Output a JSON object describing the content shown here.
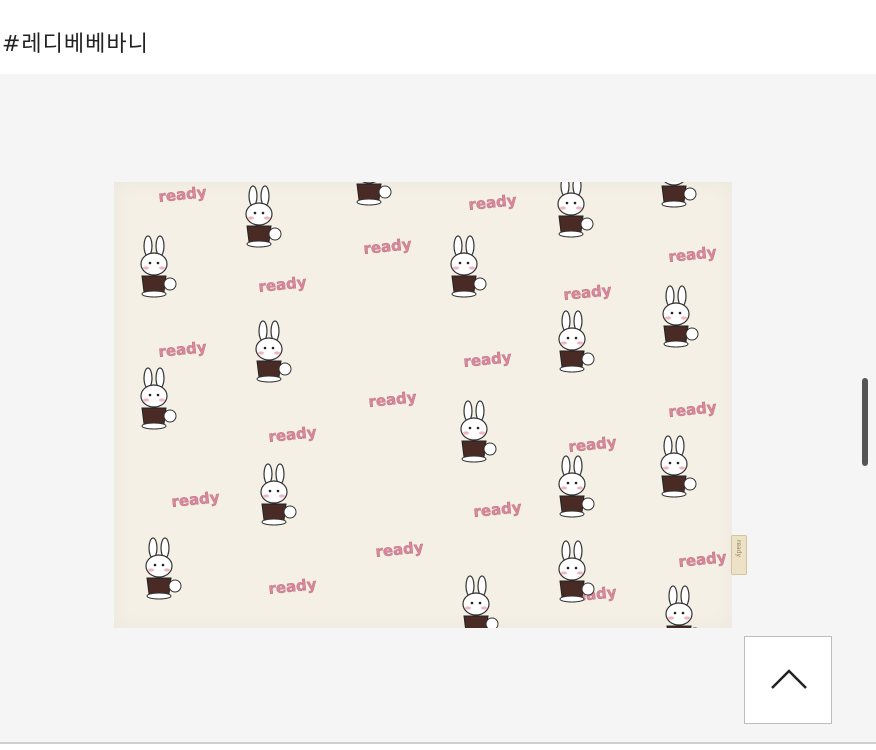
{
  "header": {
    "hashtag": "#레디베베바니"
  },
  "product_image": {
    "pattern_word": "ready",
    "accent_color": "#d9879a",
    "fabric_color": "#f4f0e6",
    "character": "bunny-icon",
    "tag_text": "ready"
  },
  "scroll_to_top": {
    "icon": "chevron-up-icon"
  },
  "scrollbar": {
    "visible": true
  }
}
